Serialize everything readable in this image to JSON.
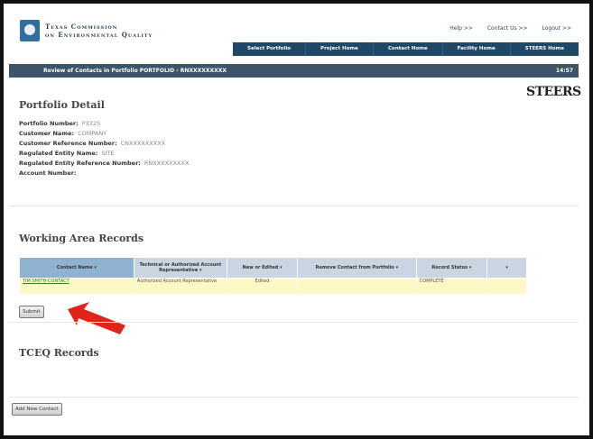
{
  "header": {
    "agency_line1": "Texas Commission",
    "agency_line2": "on Environmental Quality",
    "links": {
      "help": "Help >>",
      "contact": "Contact Us >>",
      "logout": "Logout >>"
    }
  },
  "nav": {
    "items": [
      "Select Portfolio",
      "Project Home",
      "Contact Home",
      "Facility Home",
      "STEERS Home"
    ]
  },
  "titlebar": {
    "title": "Review of Contacts in Portfolio PORTFOLIO - RNXXXXXXXXX",
    "time": "14:57"
  },
  "brand": "STEERS",
  "portfolio": {
    "heading": "Portfolio Detail",
    "fields": [
      {
        "label": "Portfolio Number:",
        "value": "P3325"
      },
      {
        "label": "Customer Name:",
        "value": "COMPANY"
      },
      {
        "label": "Customer Reference Number:",
        "value": "CNXXXXXXXXX"
      },
      {
        "label": "Regulated Entity Name:",
        "value": "SITE"
      },
      {
        "label": "Regulated Entity Reference Number:",
        "value": "RNXXXXXXXXX"
      },
      {
        "label": "Account Number:",
        "value": ""
      }
    ]
  },
  "working_area": {
    "heading": "Working Area Records",
    "columns": [
      "Contact Name",
      "Technical or Authorized Account Representative",
      "New or Edited",
      "Remove Contact from Portfolio",
      "Record Status",
      ""
    ],
    "rows": [
      [
        "TIM SMITH-CONTACT",
        "Authorized Account Representative",
        "Edited",
        "",
        "COMPLETE",
        ""
      ]
    ],
    "submit_label": "Submit"
  },
  "tceq": {
    "heading": "TCEQ Records"
  },
  "add_contact_label": "Add New Contact",
  "colors": {
    "nav": "#1f4768",
    "titlebar": "#3d5566",
    "row_highlight": "#fdf8c6",
    "arrow": "#e0241b"
  }
}
